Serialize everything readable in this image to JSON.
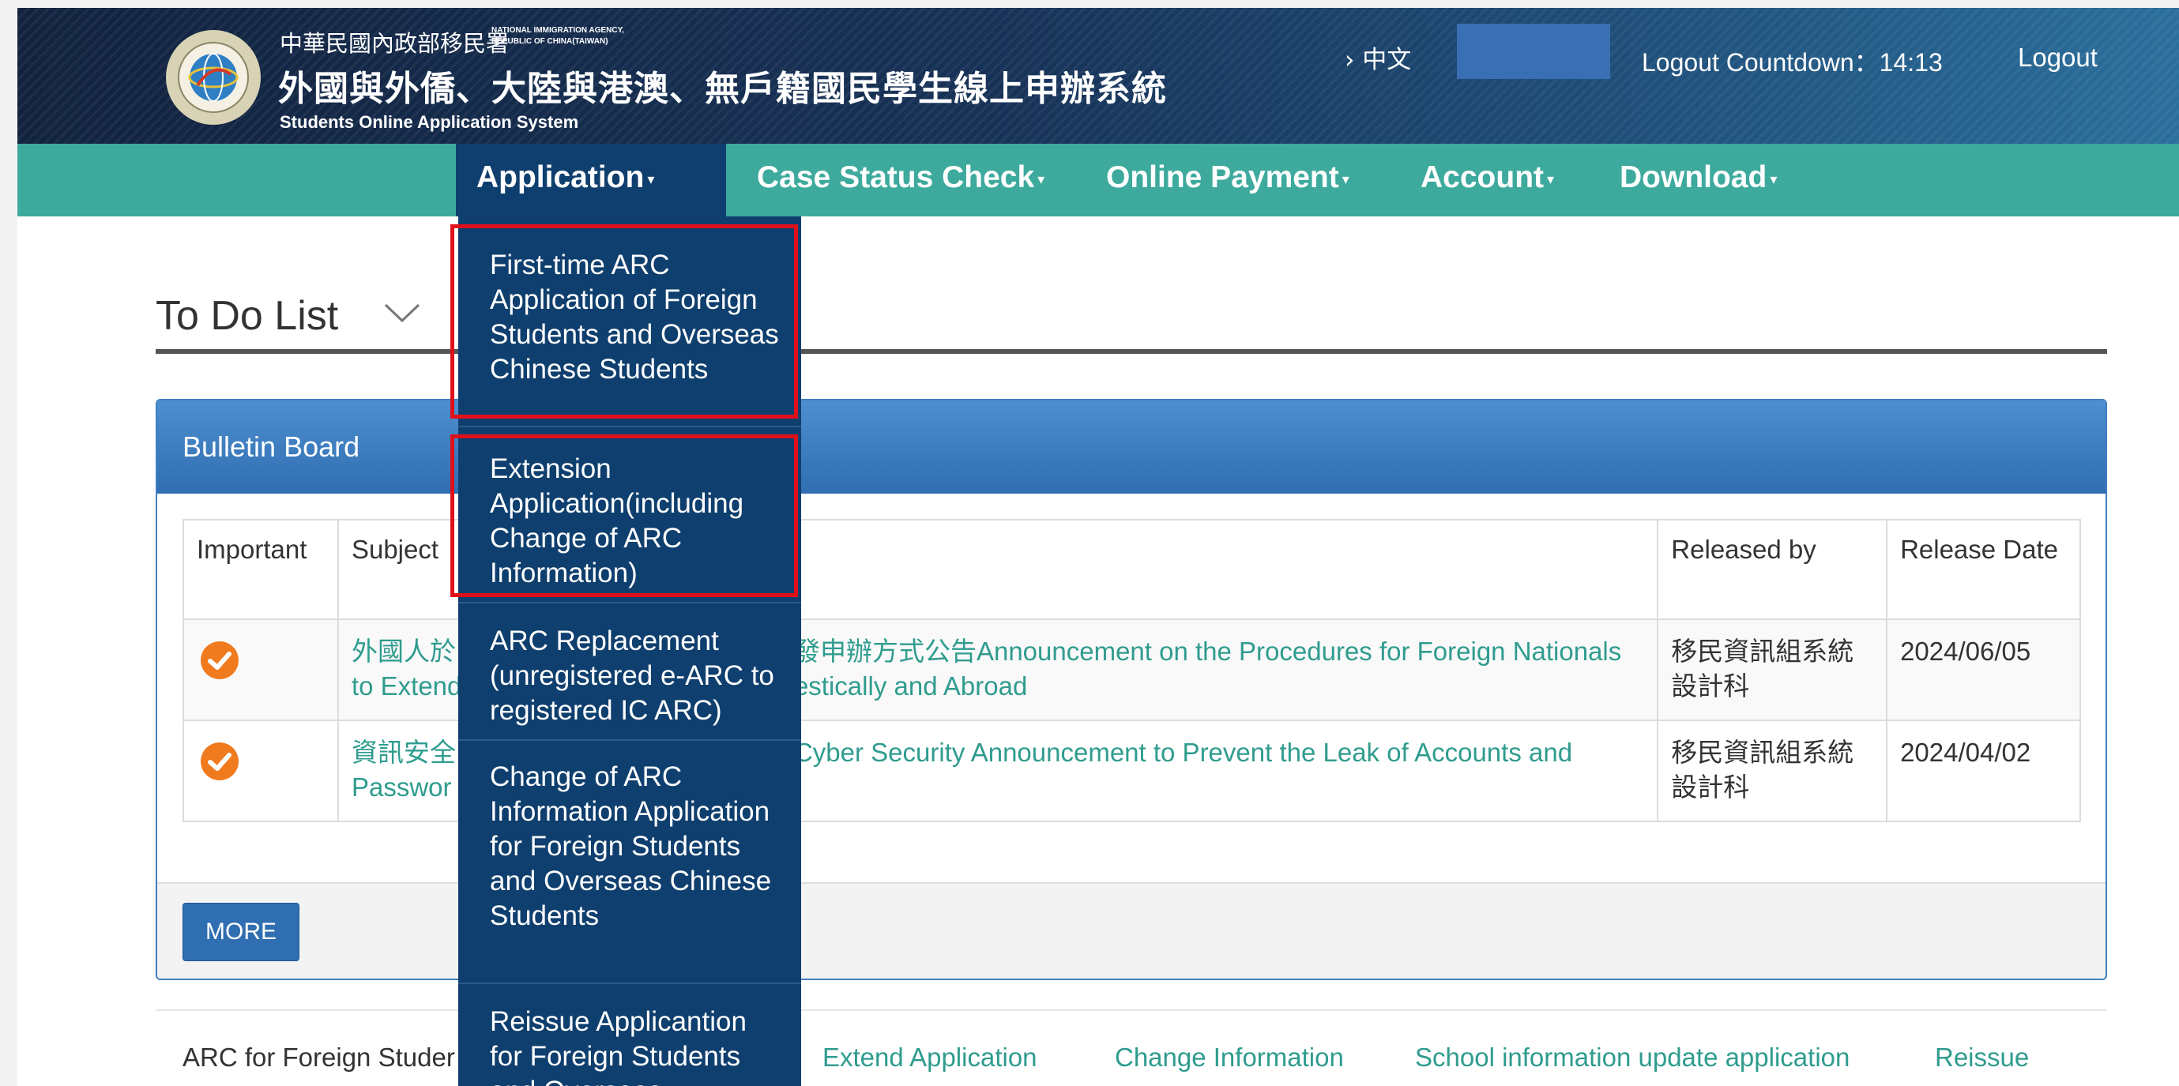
{
  "header": {
    "agency_zh": "中華民國內政部移民署",
    "agency_en": "NATIONAL IMMIGRATION AGENCY,\nREPUBLIC OF CHINA(TAIWAN)",
    "system_title_zh": "外國與外僑、大陸與港澳、無戶籍國民學生線上申辦系統",
    "system_title_en": "Students Online Application System",
    "language_switch": "› 中文",
    "logout_countdown": "Logout Countdown：14:13",
    "logout": "Logout"
  },
  "nav": {
    "items": [
      {
        "label": "Application"
      },
      {
        "label": "Case Status Check"
      },
      {
        "label": "Online Payment"
      },
      {
        "label": "Account"
      },
      {
        "label": "Download"
      }
    ]
  },
  "dropdown": {
    "items": [
      {
        "label": "First-time ARC Application of Foreign Students and Overseas Chinese Students",
        "highlighted": true
      },
      {
        "label": "Extension Application(including Change of ARC Information)",
        "highlighted": true
      },
      {
        "label": "ARC Replacement (unregistered e-ARC to registered IC ARC)",
        "highlighted": false
      },
      {
        "label": "Change of ARC Information Application for Foreign Students and Overseas Chinese Students",
        "highlighted": false
      },
      {
        "label": "Reissue Applicantion for Foreign Students and Overseas",
        "highlighted": false
      }
    ]
  },
  "todo": {
    "title": "To Do List"
  },
  "bulletin": {
    "title": "Bulletin Board",
    "columns": [
      "Important",
      "Subject",
      "Released by",
      "Release Date"
    ],
    "rows": [
      {
        "subject_prefix": "外國人於",
        "subject_prefix2": "to Extend",
        "subject_line1": "發申辦方式公告Announcement on the Procedures for Foreign Nationals",
        "subject_line2": "estically and Abroad",
        "released_by": "移民資訊組系統設計科",
        "date": "2024/06/05"
      },
      {
        "subject_prefix": "資訊安全",
        "subject_prefix2": "Passwor",
        "subject_line1": "Cyber Security Announcement to Prevent the Leak of Accounts and",
        "subject_line2": "",
        "released_by": "移民資訊組系統設計科",
        "date": "2024/04/02"
      }
    ],
    "more_label": "MORE"
  },
  "bottom_tabs": [
    "ARC for Foreign Studer",
    "Extend Application",
    "Change Information",
    "School information update application",
    "Reissue"
  ],
  "colors": {
    "nav_teal": "#3daa9d",
    "dropdown_navy": "#0f3f6e",
    "highlight_red": "#e0101a",
    "link_teal": "#2f9c8e",
    "important_orange": "#f07a1e"
  }
}
